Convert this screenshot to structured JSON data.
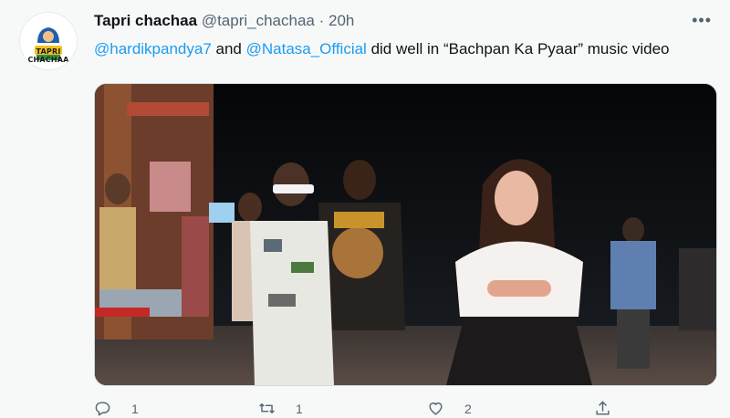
{
  "tweet": {
    "display_name": "Tapri chachaa",
    "handle": "@tapri_chachaa",
    "separator": "·",
    "time": "20h",
    "avatar_text": "TAPRI CHACHAA",
    "more_label": "•••",
    "text": {
      "mention1": "@hardikpandya7",
      "and": " and ",
      "mention2": "@Natasa_Official",
      "rest": " did well in “Bachpan Ka Pyaar” music video"
    },
    "actions": {
      "reply_count": "1",
      "retweet_count": "1",
      "like_count": "2"
    }
  },
  "colors": {
    "accent": "#1d9bf0",
    "background": "#f7f9f9",
    "secondary_text": "#536471"
  }
}
